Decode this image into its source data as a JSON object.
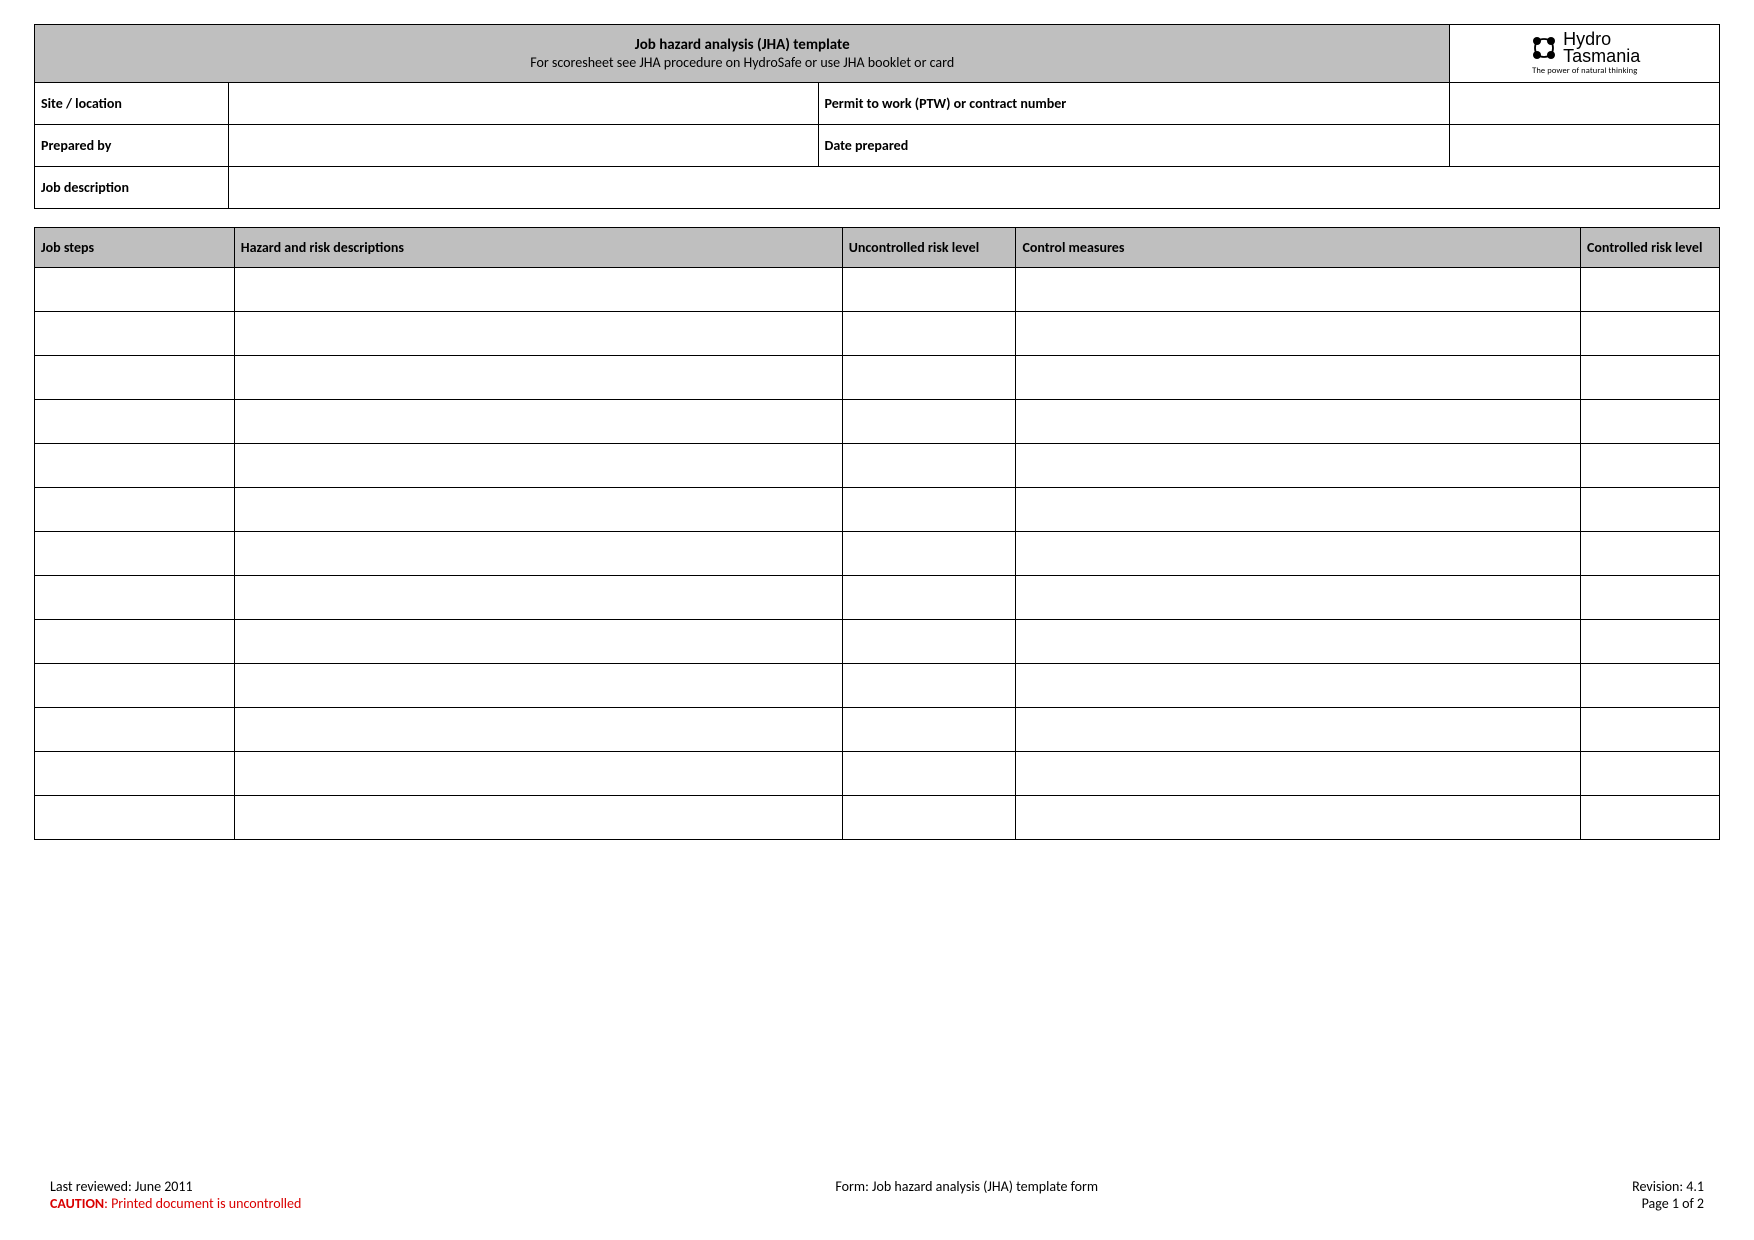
{
  "header": {
    "title_line1": "Job hazard analysis (JHA) template",
    "title_line2": "For scoresheet see JHA procedure on HydroSafe or use JHA booklet or card",
    "logo_line1": "Hydro",
    "logo_line2": "Tasmania",
    "logo_tagline": "The power of natural thinking"
  },
  "fields": {
    "site_location_label": "Site / location",
    "site_location_value": "",
    "ptw_label": "Permit to work (PTW) or contract number",
    "ptw_value": "",
    "prepared_by_label": "Prepared by",
    "prepared_by_value": "",
    "date_prepared_label": "Date prepared",
    "date_prepared_value": "",
    "job_description_label": "Job description",
    "job_description_value": ""
  },
  "steps_table": {
    "headers": {
      "job_steps": "Job steps",
      "hazard_desc": "Hazard and risk descriptions",
      "uncontrolled_risk": "Uncontrolled risk level",
      "control_measures": "Control measures",
      "controlled_risk": "Controlled risk level"
    },
    "rows": [
      {
        "job_steps": "",
        "hazard_desc": "",
        "uncontrolled_risk": "",
        "control_measures": "",
        "controlled_risk": ""
      },
      {
        "job_steps": "",
        "hazard_desc": "",
        "uncontrolled_risk": "",
        "control_measures": "",
        "controlled_risk": ""
      },
      {
        "job_steps": "",
        "hazard_desc": "",
        "uncontrolled_risk": "",
        "control_measures": "",
        "controlled_risk": ""
      },
      {
        "job_steps": "",
        "hazard_desc": "",
        "uncontrolled_risk": "",
        "control_measures": "",
        "controlled_risk": ""
      },
      {
        "job_steps": "",
        "hazard_desc": "",
        "uncontrolled_risk": "",
        "control_measures": "",
        "controlled_risk": ""
      },
      {
        "job_steps": "",
        "hazard_desc": "",
        "uncontrolled_risk": "",
        "control_measures": "",
        "controlled_risk": ""
      },
      {
        "job_steps": "",
        "hazard_desc": "",
        "uncontrolled_risk": "",
        "control_measures": "",
        "controlled_risk": ""
      },
      {
        "job_steps": "",
        "hazard_desc": "",
        "uncontrolled_risk": "",
        "control_measures": "",
        "controlled_risk": ""
      },
      {
        "job_steps": "",
        "hazard_desc": "",
        "uncontrolled_risk": "",
        "control_measures": "",
        "controlled_risk": ""
      },
      {
        "job_steps": "",
        "hazard_desc": "",
        "uncontrolled_risk": "",
        "control_measures": "",
        "controlled_risk": ""
      },
      {
        "job_steps": "",
        "hazard_desc": "",
        "uncontrolled_risk": "",
        "control_measures": "",
        "controlled_risk": ""
      },
      {
        "job_steps": "",
        "hazard_desc": "",
        "uncontrolled_risk": "",
        "control_measures": "",
        "controlled_risk": ""
      },
      {
        "job_steps": "",
        "hazard_desc": "",
        "uncontrolled_risk": "",
        "control_measures": "",
        "controlled_risk": ""
      }
    ]
  },
  "footer": {
    "last_reviewed": "Last reviewed: June 2011",
    "caution_label": "CAUTION",
    "caution_text": ": Printed document is uncontrolled",
    "form_name": "Form: Job hazard analysis (JHA) template form",
    "revision": "Revision: 4.1",
    "page": "Page 1 of 2"
  }
}
